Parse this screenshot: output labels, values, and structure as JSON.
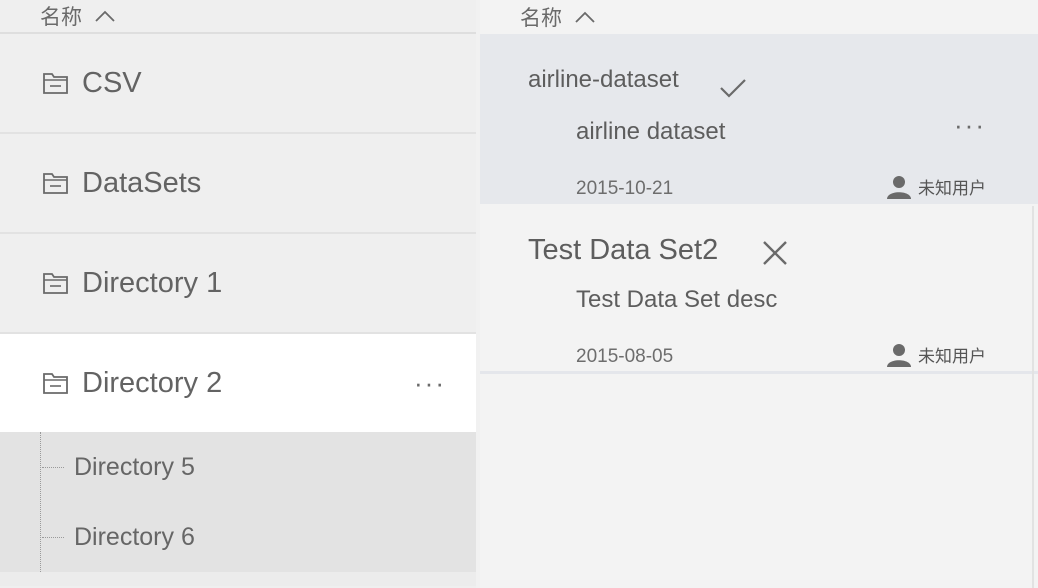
{
  "left_panel": {
    "header": {
      "label": "名称",
      "sort_icon": "chevron-up-icon"
    },
    "directories": [
      {
        "label": "CSV",
        "icon": "folder-icon"
      },
      {
        "label": "DataSets",
        "icon": "folder-icon"
      },
      {
        "label": "Directory 1",
        "icon": "folder-icon"
      },
      {
        "label": "Directory 2",
        "icon": "folder-icon",
        "selected": true,
        "more": "···"
      }
    ],
    "children": [
      {
        "label": "Directory 5"
      },
      {
        "label": "Directory 6"
      }
    ]
  },
  "right_panel": {
    "header": {
      "label": "名称",
      "sort_icon": "chevron-up-icon"
    },
    "datasets": [
      {
        "name": "airline-dataset",
        "status_icon": "checkmark-icon",
        "description": "airline dataset",
        "date": "2015-10-21",
        "owner": "未知用户",
        "more": "···"
      },
      {
        "name": "Test Data Set2",
        "status_icon": "close-icon",
        "description": "Test Data Set desc",
        "date": "2015-08-05",
        "owner": "未知用户"
      }
    ]
  },
  "colors": {
    "selected_bg": "#ffffff",
    "active_card_bg": "#e6e8ec",
    "children_bg": "#e3e3e3",
    "text": "#5f5f5f"
  }
}
